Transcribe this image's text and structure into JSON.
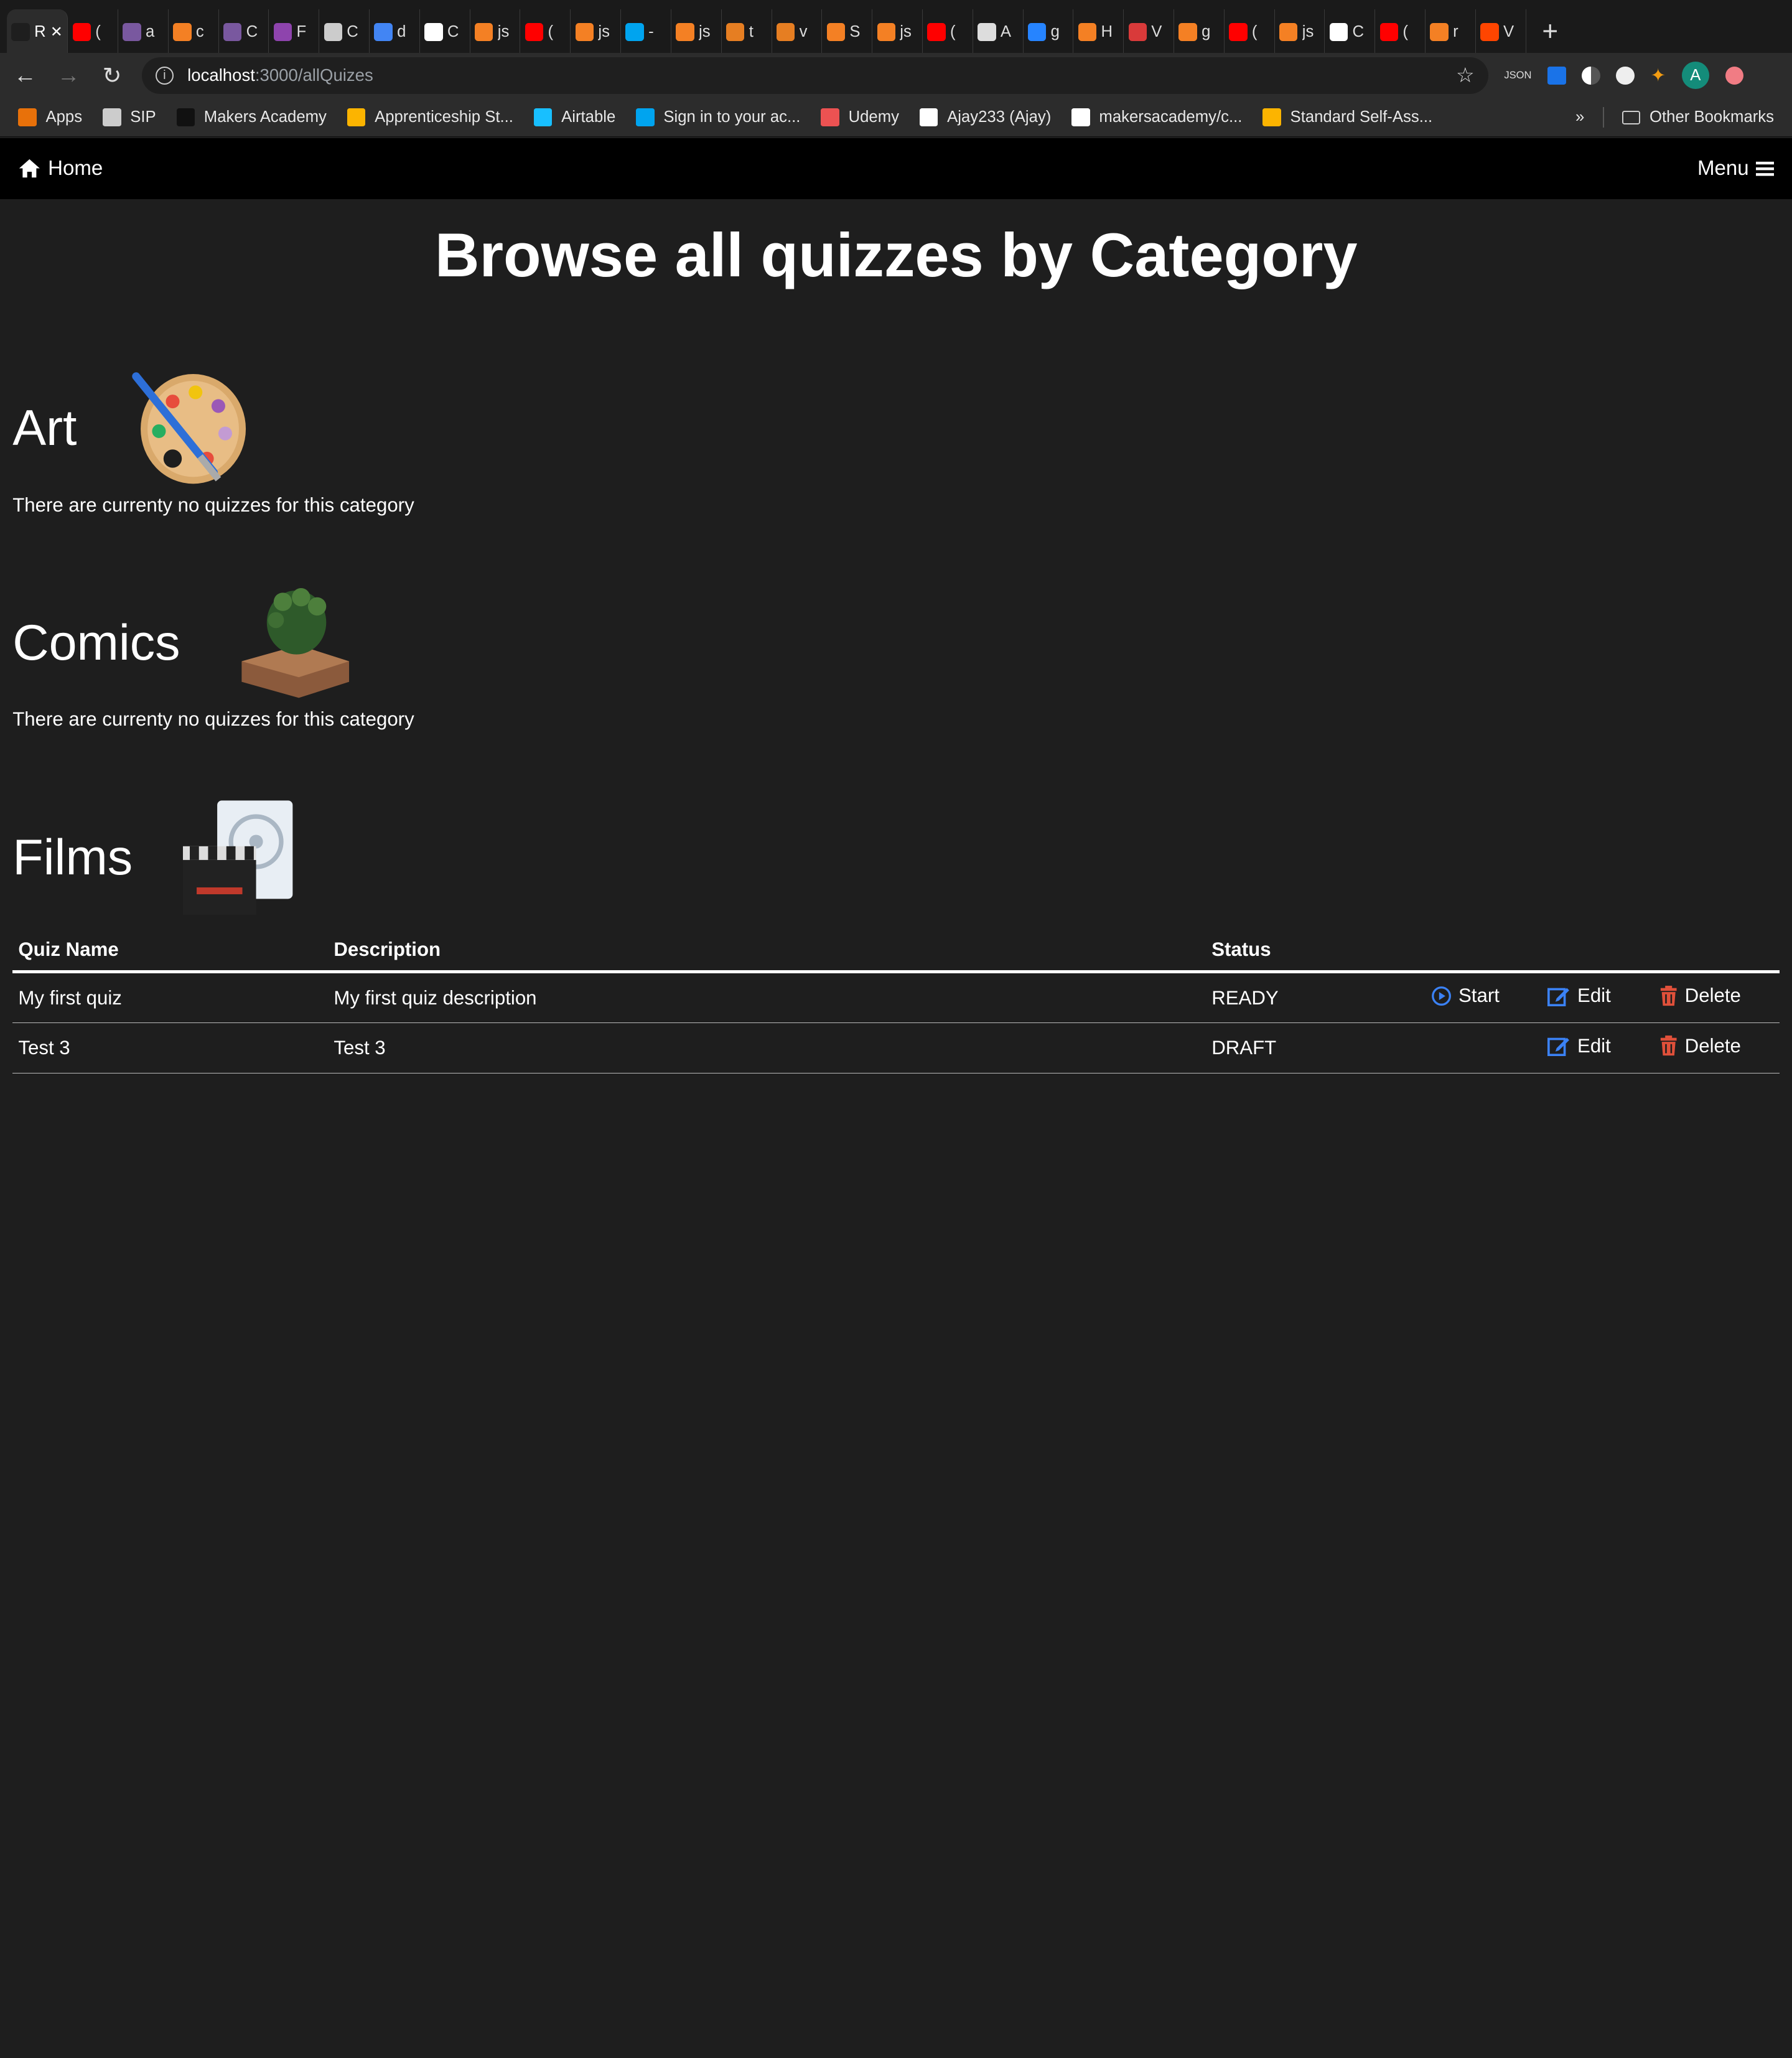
{
  "browser": {
    "tabs": [
      {
        "title": "R",
        "icon": "react-icon",
        "color": "#1e1e1e",
        "active": true
      },
      {
        "title": "(",
        "icon": "youtube-icon",
        "color": "#ff0000"
      },
      {
        "title": "a",
        "icon": "heroku-icon",
        "color": "#79589f"
      },
      {
        "title": "c",
        "icon": "stackoverflow-icon",
        "color": "#f48024"
      },
      {
        "title": "C",
        "icon": "heroku-icon",
        "color": "#79589f"
      },
      {
        "title": "F",
        "icon": "trello-icon",
        "color": "#8e44ad"
      },
      {
        "title": "C",
        "icon": "circleci-icon",
        "color": "#cccccc"
      },
      {
        "title": "d",
        "icon": "google-icon",
        "color": "#4285f4"
      },
      {
        "title": "C",
        "icon": "github-icon",
        "color": "#ffffff"
      },
      {
        "title": "js",
        "icon": "stackoverflow-icon",
        "color": "#f48024"
      },
      {
        "title": "(",
        "icon": "youtube-icon",
        "color": "#ff0000"
      },
      {
        "title": "js",
        "icon": "stackoverflow-icon",
        "color": "#f48024"
      },
      {
        "title": "-",
        "icon": "microsoft-icon",
        "color": "#00a4ef"
      },
      {
        "title": "js",
        "icon": "stackoverflow-icon",
        "color": "#f48024"
      },
      {
        "title": "t",
        "icon": "orange-icon",
        "color": "#e67e22"
      },
      {
        "title": "v",
        "icon": "orange-icon",
        "color": "#e67e22"
      },
      {
        "title": "S",
        "icon": "stackoverflow-icon",
        "color": "#f48024"
      },
      {
        "title": "js",
        "icon": "stackoverflow-icon",
        "color": "#f48024"
      },
      {
        "title": "(",
        "icon": "youtube-icon",
        "color": "#ff0000"
      },
      {
        "title": "A",
        "icon": "crown-icon",
        "color": "#dddddd"
      },
      {
        "title": "g",
        "icon": "atlassian-icon",
        "color": "#2684ff"
      },
      {
        "title": "H",
        "icon": "stackoverflow-icon",
        "color": "#f48024"
      },
      {
        "title": "V",
        "icon": "v-icon",
        "color": "#d93a3a"
      },
      {
        "title": "g",
        "icon": "stackoverflow-icon",
        "color": "#f48024"
      },
      {
        "title": "(",
        "icon": "youtube-icon",
        "color": "#ff0000"
      },
      {
        "title": "js",
        "icon": "stackoverflow-icon",
        "color": "#f48024"
      },
      {
        "title": "C",
        "icon": "github-icon",
        "color": "#ffffff"
      },
      {
        "title": "(",
        "icon": "youtube-icon",
        "color": "#ff0000"
      },
      {
        "title": "r",
        "icon": "stackoverflow-icon",
        "color": "#f48024"
      },
      {
        "title": "V",
        "icon": "reddit-icon",
        "color": "#ff4500"
      }
    ],
    "url_host": "localhost",
    "url_path": ":3000/allQuizes",
    "avatar_letter": "A",
    "bookmarks": [
      {
        "label": "Apps",
        "icon": "apps-grid-icon",
        "color": "#e8710a"
      },
      {
        "label": "SIP",
        "icon": "folder-icon",
        "color": "#cccccc"
      },
      {
        "label": "Makers Academy",
        "icon": "makers-icon",
        "color": "#111111"
      },
      {
        "label": "Apprenticeship St...",
        "icon": "airtable-icon",
        "color": "#fcb400"
      },
      {
        "label": "Airtable",
        "icon": "airtable-icon",
        "color": "#18bfff"
      },
      {
        "label": "Sign in to your ac...",
        "icon": "microsoft-icon",
        "color": "#00a4ef"
      },
      {
        "label": "Udemy",
        "icon": "udemy-icon",
        "color": "#ec5252"
      },
      {
        "label": "Ajay233 (Ajay)",
        "icon": "github-icon",
        "color": "#ffffff"
      },
      {
        "label": "makersacademy/c...",
        "icon": "github-icon",
        "color": "#ffffff"
      },
      {
        "label": "Standard Self-Ass...",
        "icon": "airtable-icon",
        "color": "#fcb400"
      }
    ],
    "more_label": "»",
    "other_bookmarks": "Other Bookmarks"
  },
  "nav": {
    "home_label": "Home",
    "menu_label": "Menu"
  },
  "page": {
    "title": "Browse all quizzes by Category",
    "categories": [
      {
        "name": "Art",
        "icon": "palette-icon",
        "empty_text": "There are currenty no quizzes for this category"
      },
      {
        "name": "Comics",
        "icon": "hulk-fist-icon",
        "empty_text": "There are currenty no quizzes for this category"
      },
      {
        "name": "Films",
        "icon": "film-clapper-icon"
      }
    ],
    "table": {
      "headers": [
        "Quiz Name",
        "Description",
        "Status"
      ],
      "rows": [
        {
          "name": "My first quiz",
          "description": "My first quiz description",
          "status": "READY",
          "start": "Start",
          "edit": "Edit",
          "delete": "Delete"
        },
        {
          "name": "Test 3",
          "description": "Test 3",
          "status": "DRAFT",
          "edit": "Edit",
          "delete": "Delete"
        }
      ]
    }
  },
  "colors": {
    "action_blue": "#3b82f6",
    "delete_red": "#e0503a",
    "page_bg": "#1e1e1e",
    "navbar_bg": "#000000"
  }
}
